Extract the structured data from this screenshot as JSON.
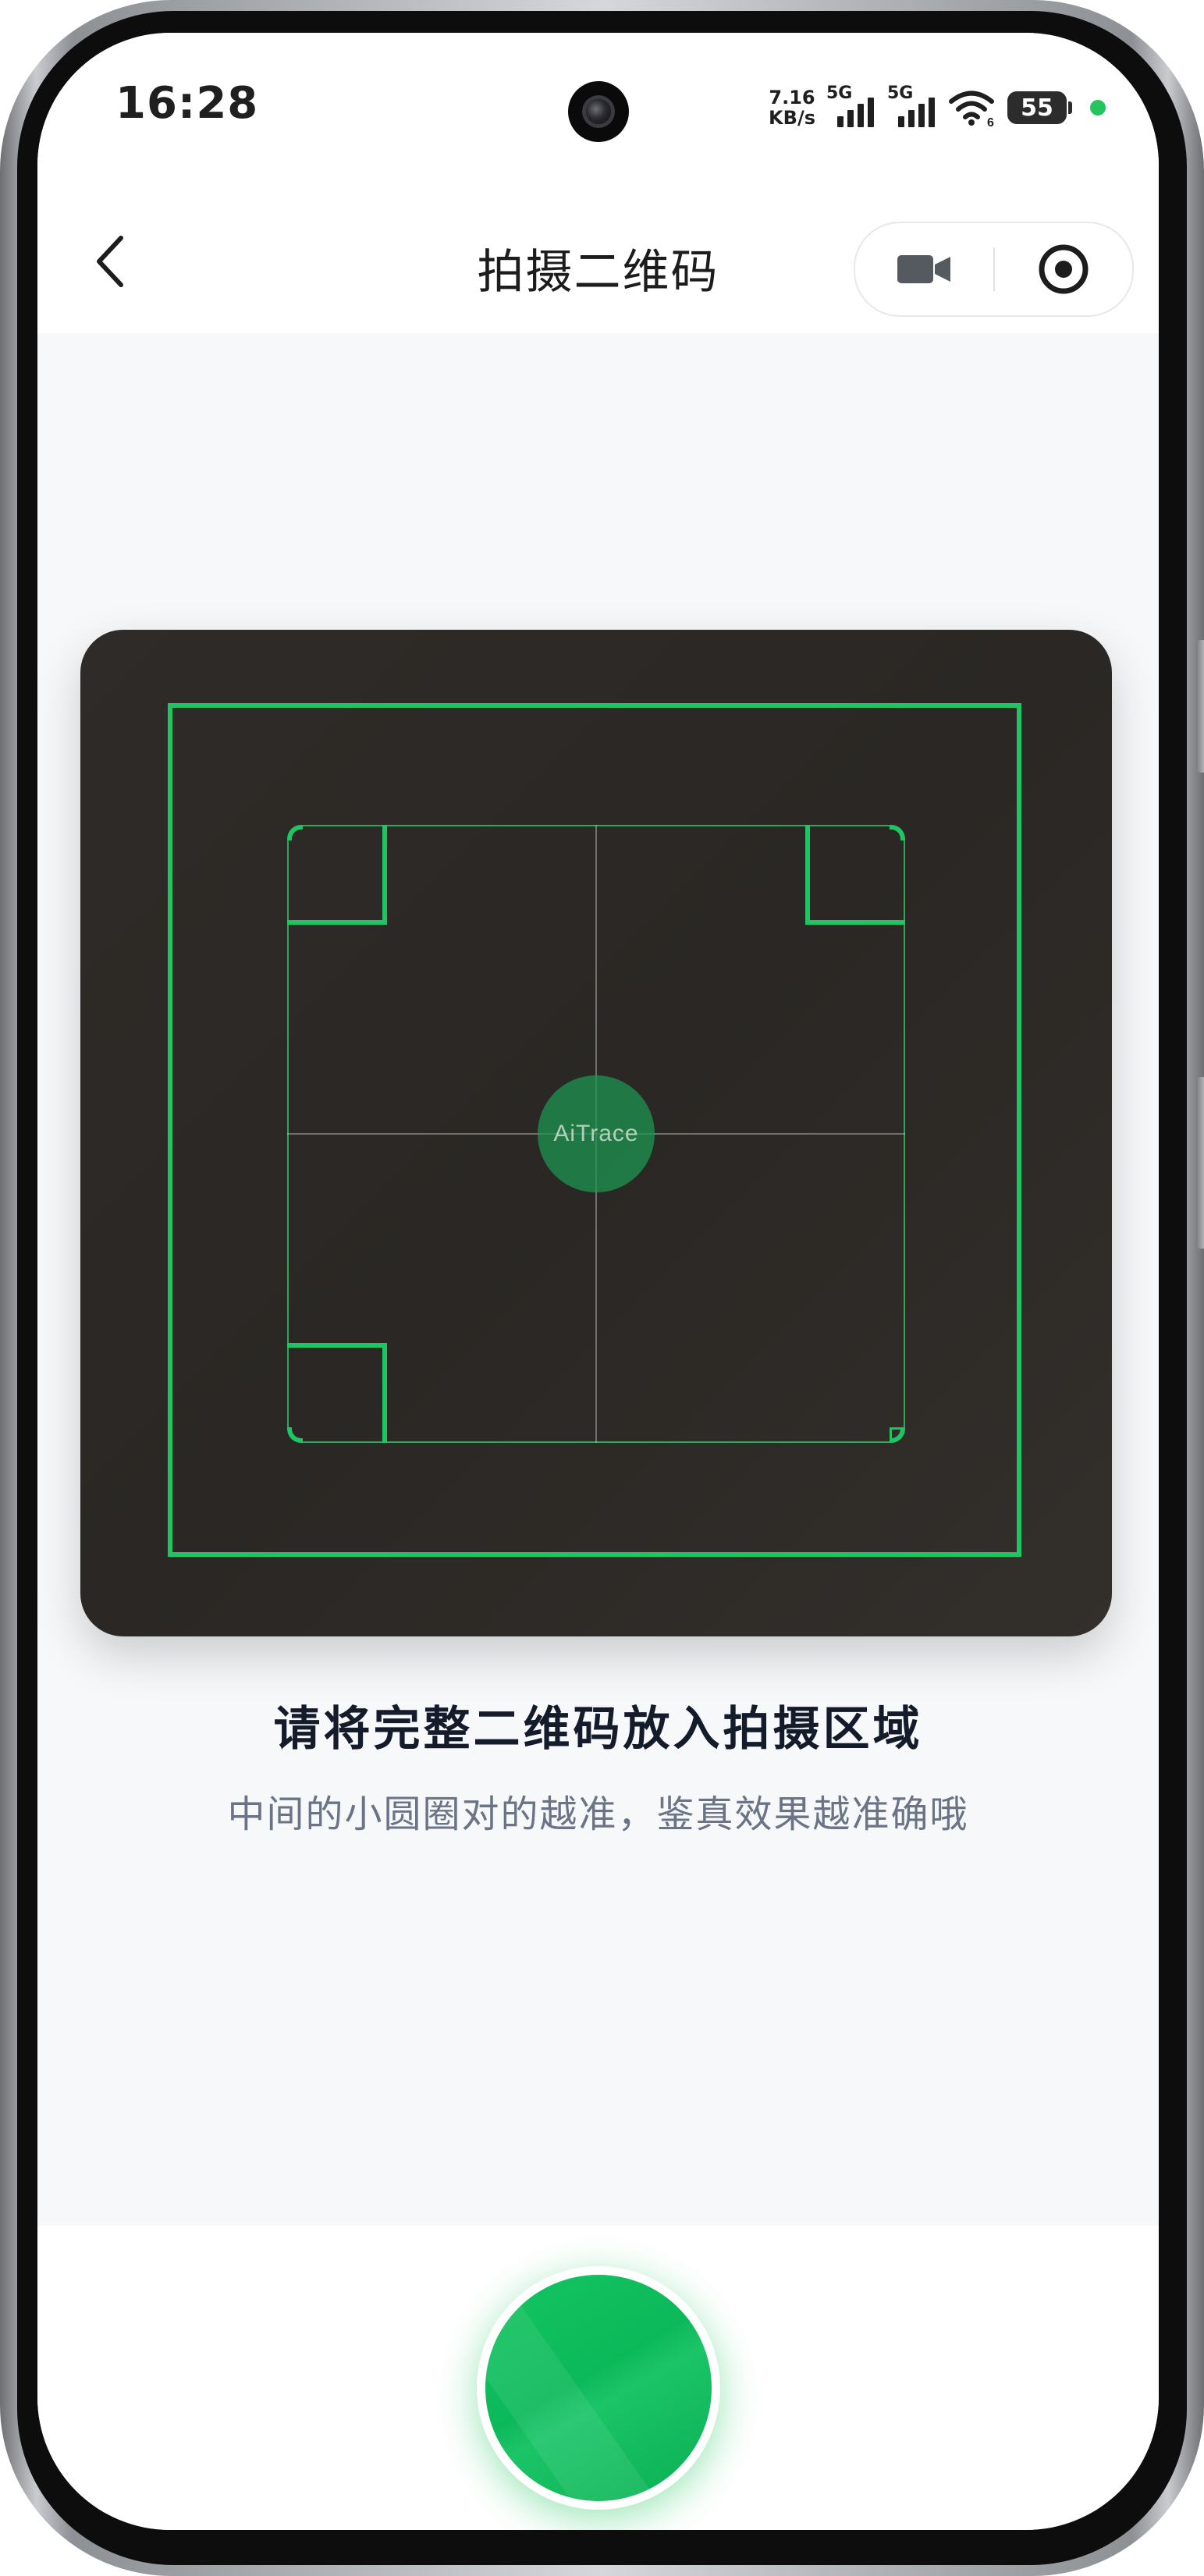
{
  "status_bar": {
    "time": "16:28",
    "net_speed_value": "7.16",
    "net_speed_unit": "KB/s",
    "signal_1_label": "5G",
    "signal_2_label": "5G",
    "wifi_badge": "6",
    "battery_level": "55",
    "indicator_color": "#22c55e"
  },
  "nav": {
    "title": "拍摄二维码",
    "back_icon": "chevron-left-icon",
    "capsule_left_icon": "video-camera-icon",
    "capsule_right_icon": "record-target-icon"
  },
  "scanner": {
    "watermark": "AiTrace",
    "frame_color": "#1fc463",
    "background_color": "#2c2925"
  },
  "instructions": {
    "headline": "请将完整二维码放入拍摄区域",
    "hint": "中间的小圆圈对的越准，鉴真效果越准确哦"
  },
  "shutter": {
    "color": "#10bd5c"
  }
}
